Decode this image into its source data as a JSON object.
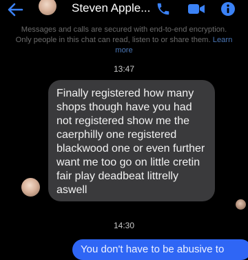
{
  "header": {
    "contact_name": "Steven Apple...",
    "icons": [
      "back-arrow-icon",
      "phone-icon",
      "video-camera-icon",
      "info-icon"
    ],
    "accent_color": "#3b82f6"
  },
  "encryption_notice": {
    "text": "Messages and calls are secured with end-to-end encryption. Only people in this chat can read, listen to or share them.",
    "link": "Learn more"
  },
  "messages": [
    {
      "timestamp": "13:47",
      "direction": "incoming",
      "text": "Finally registered how many shops though have you had not registered show me the caerphilly one registered blackwood one or even further want me too go on little cretin fair play deadbeat littrelly aswell"
    },
    {
      "timestamp": "14:30",
      "direction": "outgoing",
      "text": "You don't have to be abusive to"
    }
  ]
}
